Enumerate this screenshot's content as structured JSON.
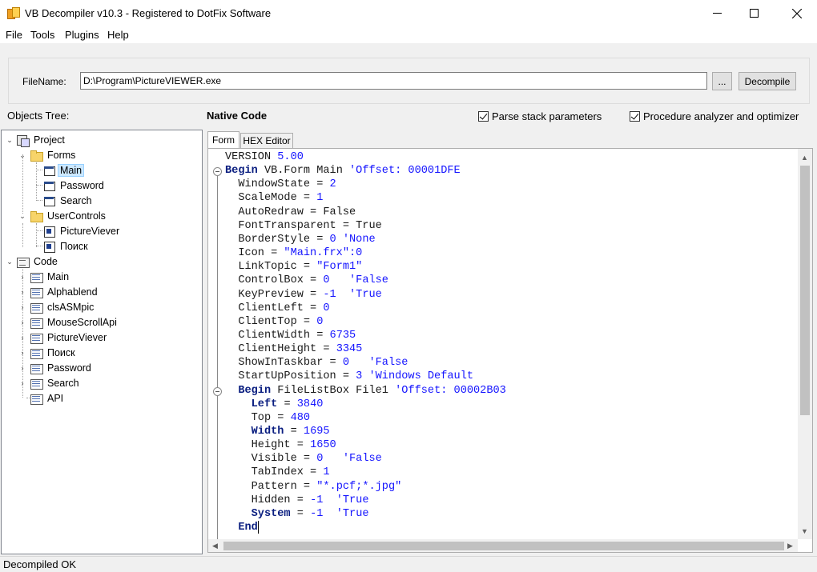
{
  "window": {
    "title": "VB Decompiler v10.3 - Registered to DotFix Software"
  },
  "menu": [
    "File",
    "Tools",
    "Plugins",
    "Help"
  ],
  "file_panel": {
    "label": "FileName:",
    "value": "D:\\Program\\PictureVIEWER.exe",
    "browse_label": "...",
    "decompile_label": "Decompile"
  },
  "header": {
    "objects_tree_label": "Objects Tree:",
    "native_code_label": "Native Code",
    "parse_stack_label": "Parse stack parameters",
    "procedure_analyzer_label": "Procedure analyzer and optimizer",
    "parse_stack_checked": true,
    "procedure_analyzer_checked": true
  },
  "tree": {
    "project": "Project",
    "forms": "Forms",
    "form_items": [
      "Main",
      "Password",
      "Search"
    ],
    "user_controls": "UserControls",
    "control_items": [
      "PictureViever",
      "Поиск"
    ],
    "code": "Code",
    "code_items": [
      "Main",
      "Alphablend",
      "clsASMpic",
      "MouseScrollApi",
      "PictureViever",
      "Поиск",
      "Password",
      "Search",
      "API"
    ],
    "selected": "Main"
  },
  "tabs": [
    "Form",
    "HEX Editor"
  ],
  "code_lines": [
    {
      "k": "",
      "t": "VERSION ",
      "v": "5.00",
      "c": ""
    },
    {
      "k": "Begin",
      "t": " VB.Form Main ",
      "v": "",
      "c": "'Offset: 00001DFE"
    },
    {
      "k": "",
      "t": "  WindowState = ",
      "v": "2",
      "c": ""
    },
    {
      "k": "",
      "t": "  ScaleMode = ",
      "v": "1",
      "c": ""
    },
    {
      "k": "",
      "t": "  AutoRedraw = False",
      "v": "",
      "c": ""
    },
    {
      "k": "",
      "t": "  FontTransparent = True",
      "v": "",
      "c": ""
    },
    {
      "k": "",
      "t": "  BorderStyle = ",
      "v": "0",
      "c": " 'None"
    },
    {
      "k": "",
      "t": "  Icon = ",
      "v": "\"Main.frx\":0",
      "c": ""
    },
    {
      "k": "",
      "t": "  LinkTopic = ",
      "v": "\"Form1\"",
      "c": ""
    },
    {
      "k": "",
      "t": "  ControlBox = ",
      "v": "0",
      "c": "   'False"
    },
    {
      "k": "",
      "t": "  KeyPreview = ",
      "v": "-1",
      "c": "  'True"
    },
    {
      "k": "",
      "t": "  ClientLeft = ",
      "v": "0",
      "c": ""
    },
    {
      "k": "",
      "t": "  ClientTop = ",
      "v": "0",
      "c": ""
    },
    {
      "k": "",
      "t": "  ClientWidth = ",
      "v": "6735",
      "c": ""
    },
    {
      "k": "",
      "t": "  ClientHeight = ",
      "v": "3345",
      "c": ""
    },
    {
      "k": "",
      "t": "  ShowInTaskbar = ",
      "v": "0",
      "c": "   'False"
    },
    {
      "k": "",
      "t": "  StartUpPosition = ",
      "v": "3",
      "c": " 'Windows Default"
    },
    {
      "k": "Begin",
      "t": " FileListBox File1 ",
      "v": "",
      "c": "'Offset: 00002B03",
      "indent": "  "
    },
    {
      "k": "Left",
      "t": " = ",
      "v": "3840",
      "c": "",
      "indent": "    "
    },
    {
      "k": "",
      "t": "    Top = ",
      "v": "480",
      "c": ""
    },
    {
      "k": "Width",
      "t": " = ",
      "v": "1695",
      "c": "",
      "indent": "    "
    },
    {
      "k": "",
      "t": "    Height = ",
      "v": "1650",
      "c": ""
    },
    {
      "k": "",
      "t": "    Visible = ",
      "v": "0",
      "c": "   'False"
    },
    {
      "k": "",
      "t": "    TabIndex = ",
      "v": "1",
      "c": ""
    },
    {
      "k": "",
      "t": "    Pattern = ",
      "v": "\"*.pcf;*.jpg\"",
      "c": ""
    },
    {
      "k": "",
      "t": "    Hidden = ",
      "v": "-1",
      "c": "  'True"
    },
    {
      "k": "System",
      "t": " = ",
      "v": "-1",
      "c": "  'True",
      "indent": "    "
    },
    {
      "k": "End",
      "t": "",
      "v": "",
      "c": "",
      "indent": "  "
    }
  ],
  "status": "Decompiled OK"
}
